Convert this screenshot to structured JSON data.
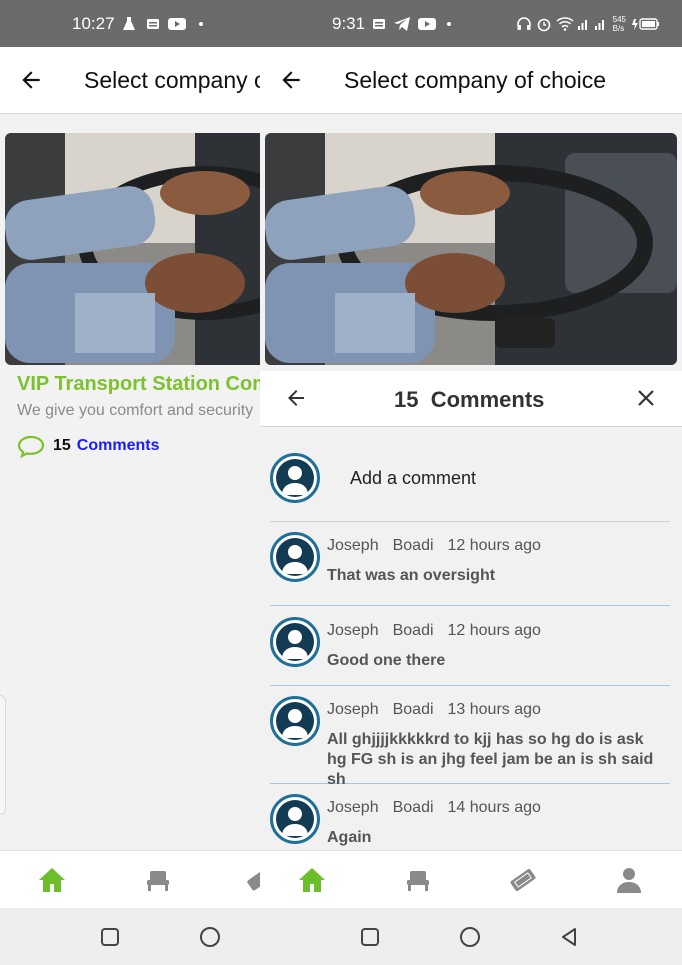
{
  "left": {
    "status": {
      "time": "10:27"
    },
    "appbar": {
      "title": "Select company of choice"
    },
    "card": {
      "title": "VIP Transport Station Company",
      "subtitle": "We give you comfort and security",
      "comment_count": "15",
      "comment_label": "Comments"
    }
  },
  "right": {
    "status": {
      "time": "9:31",
      "net_speed_value": "545",
      "net_speed_unit": "B/s"
    },
    "appbar": {
      "title": "Select company of choice"
    },
    "sheet": {
      "count": "15",
      "label": "Comments",
      "add_placeholder": "Add a comment",
      "comments": [
        {
          "first": "Joseph",
          "last": "Boadi",
          "time": "12 hours ago",
          "text": "That was an oversight"
        },
        {
          "first": "Joseph",
          "last": "Boadi",
          "time": "12 hours ago",
          "text": "Good one there"
        },
        {
          "first": "Joseph",
          "last": "Boadi",
          "time": "13 hours ago",
          "text": "All ghjjjjkkkkkrd to kjj has so hg do is ask hg FG sh is an jhg feel jam be an is sh said sh"
        },
        {
          "first": "Joseph",
          "last": "Boadi",
          "time": "14 hours ago",
          "text": "Again"
        }
      ]
    }
  },
  "colors": {
    "accent_green": "#7cc22d",
    "link_blue": "#1a1aff",
    "avatar_ring": "#1f6f99",
    "avatar_fill": "#133b54"
  },
  "icons": [
    "back-arrow-icon",
    "close-icon",
    "comment-bubble-icon",
    "home-icon",
    "seat-icon",
    "ticket-icon",
    "profile-icon",
    "user-avatar-icon"
  ]
}
